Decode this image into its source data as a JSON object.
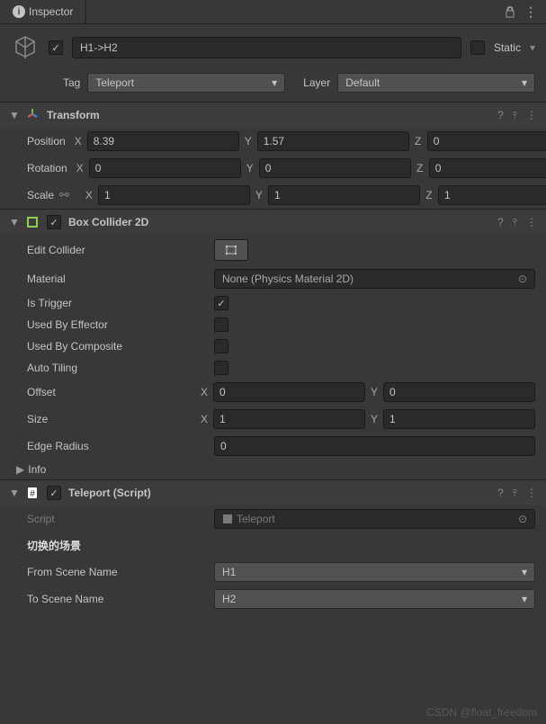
{
  "header": {
    "tab_title": "Inspector"
  },
  "gameobject": {
    "enabled": true,
    "name": "H1->H2",
    "static_label": "Static",
    "tag_label": "Tag",
    "tag_value": "Teleport",
    "layer_label": "Layer",
    "layer_value": "Default"
  },
  "transform": {
    "title": "Transform",
    "position_label": "Position",
    "position": {
      "x": "8.39",
      "y": "1.57",
      "z": "0"
    },
    "rotation_label": "Rotation",
    "rotation": {
      "x": "0",
      "y": "0",
      "z": "0"
    },
    "scale_label": "Scale",
    "scale": {
      "x": "1",
      "y": "1",
      "z": "1"
    }
  },
  "boxcollider": {
    "title": "Box Collider 2D",
    "edit_label": "Edit Collider",
    "material_label": "Material",
    "material_value": "None (Physics Material 2D)",
    "is_trigger_label": "Is Trigger",
    "is_trigger": true,
    "used_by_effector_label": "Used By Effector",
    "used_by_composite_label": "Used By Composite",
    "auto_tiling_label": "Auto Tiling",
    "offset_label": "Offset",
    "offset": {
      "x": "0",
      "y": "0"
    },
    "size_label": "Size",
    "size": {
      "x": "1",
      "y": "1"
    },
    "edge_radius_label": "Edge Radius",
    "edge_radius": "0",
    "info_label": "Info"
  },
  "teleport": {
    "title": "Teleport (Script)",
    "script_label": "Script",
    "script_value": "Teleport",
    "section_header": "切换的场景",
    "from_label": "From Scene Name",
    "from_value": "H1",
    "to_label": "To Scene Name",
    "to_value": "H2"
  },
  "watermark": "CSDN @float_freedom"
}
